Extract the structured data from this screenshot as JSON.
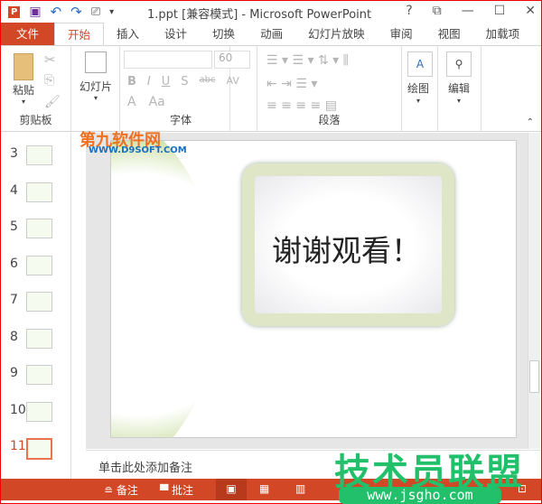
{
  "title": "1.ppt [兼容模式] - Microsoft PowerPoint",
  "window_buttons": [
    "?",
    "⧉",
    "—",
    "☐",
    "✕"
  ],
  "tabs": [
    "文件",
    "开始",
    "插入",
    "设计",
    "切换",
    "动画",
    "幻灯片放映",
    "审阅",
    "视图",
    "加载项"
  ],
  "ribbon": {
    "clipboard": {
      "paste": "粘贴",
      "label": "剪贴板"
    },
    "slides": {
      "new_slide": "幻灯片"
    },
    "font": {
      "size": "60",
      "label": "字体",
      "bold": "B",
      "italic": "I",
      "underline": "U",
      "shadow": "S",
      "strike": "abc",
      "spacing": "AV",
      "color": "A",
      "case": "Aa"
    },
    "paragraph": {
      "label": "段落"
    },
    "drawing": {
      "label": "绘图"
    },
    "editing": {
      "label": "编辑"
    }
  },
  "slides": {
    "numbers": [
      "3",
      "4",
      "5",
      "6",
      "7",
      "8",
      "9",
      "10",
      "11"
    ],
    "selected": "11"
  },
  "slide_text": "谢谢观看！",
  "notes_placeholder": "单击此处添加备注",
  "status": {
    "notes": "备注",
    "comments": "批注"
  },
  "watermarks": {
    "top": "第九软件网",
    "top_url": "WWW.D9SOFT.COM",
    "bottom": "技术员联盟",
    "bottom_url": "www.jsgho.com"
  },
  "colors": {
    "accent": "#d24726",
    "green": "#22c06a"
  }
}
